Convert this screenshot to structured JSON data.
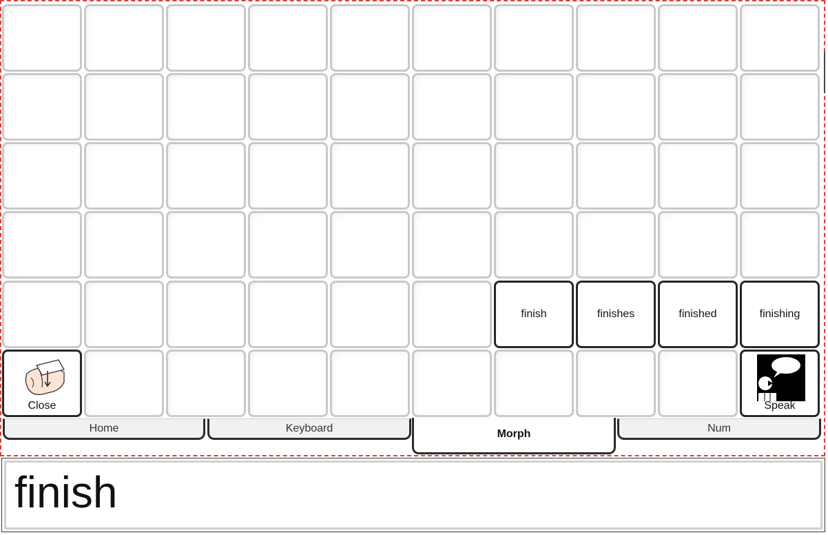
{
  "buttons": {
    "finish": "finish",
    "finishes": "finishes",
    "finished": "finished",
    "finishing": "finishing",
    "close": "Close",
    "speak": "Speak"
  },
  "icons": {
    "close": "close-hands-icon",
    "speak": "speak-person-bubble-icon"
  },
  "tabs": {
    "home": "Home",
    "keyboard": "Keyboard",
    "morph": "Morph",
    "num": "Num",
    "selected": "Morph"
  },
  "output": {
    "text": "finish"
  },
  "colors": {
    "frame_dash": "#e53935",
    "active_border": "#262626",
    "inactive_border": "#c9c9c9",
    "tab_bg": "#f0f1f1"
  }
}
